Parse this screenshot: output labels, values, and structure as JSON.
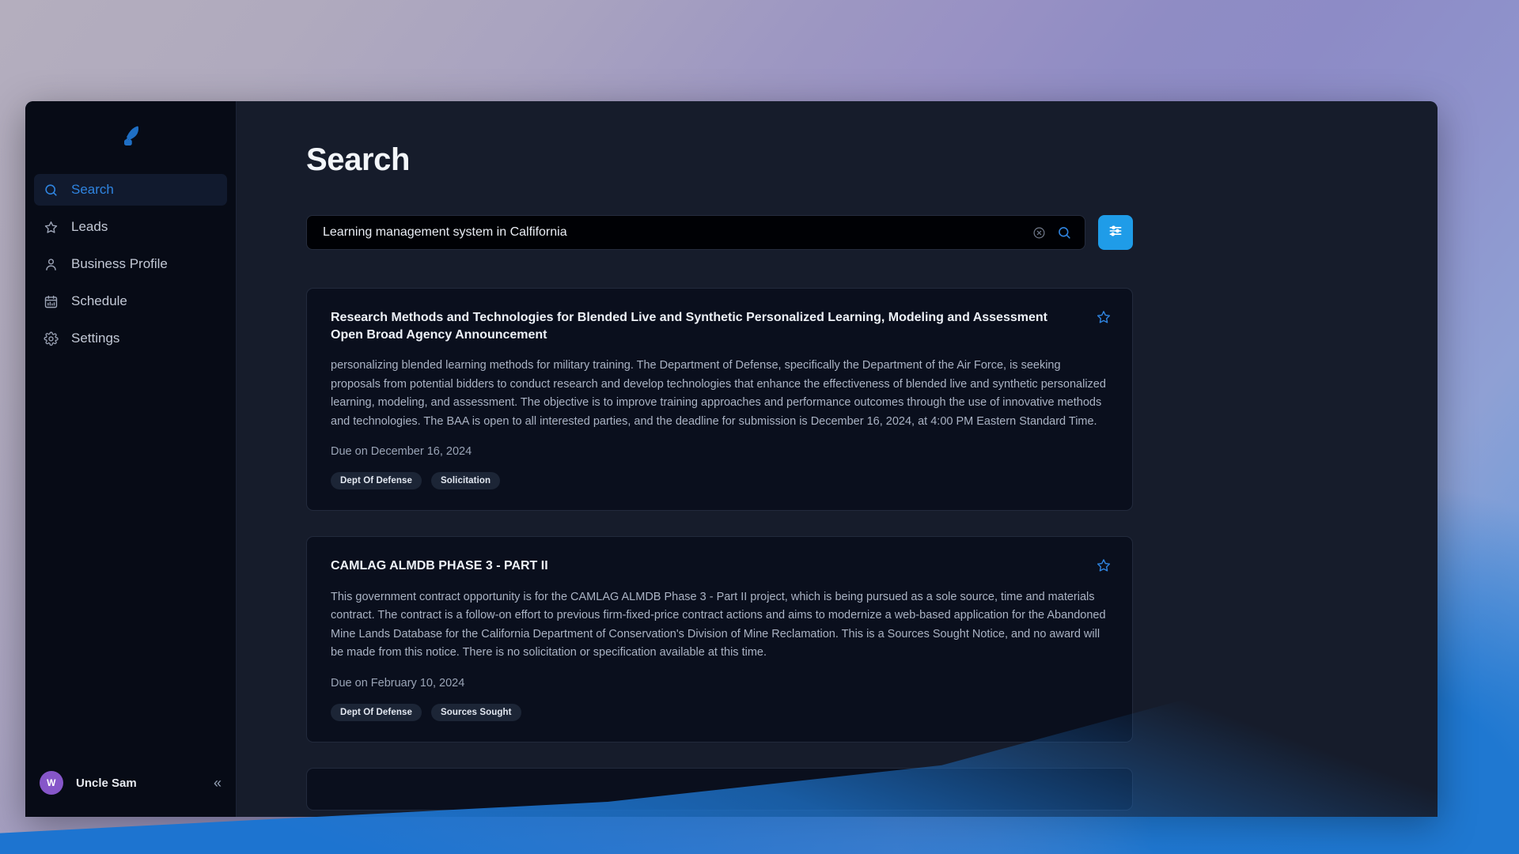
{
  "app": {
    "logo_icon": "quill-pen-icon"
  },
  "sidebar": {
    "items": [
      {
        "label": "Search",
        "icon": "search-icon",
        "active": true
      },
      {
        "label": "Leads",
        "icon": "star-icon",
        "active": false
      },
      {
        "label": "Business Profile",
        "icon": "user-icon",
        "active": false
      },
      {
        "label": "Schedule",
        "icon": "calendar-icon",
        "active": false
      },
      {
        "label": "Settings",
        "icon": "gear-icon",
        "active": false
      }
    ],
    "user": {
      "name": "Uncle Sam",
      "avatar_initial": "W"
    },
    "collapse_glyph": "«"
  },
  "main": {
    "page_title": "Search",
    "search": {
      "value": "Learning management system in Calfifornia",
      "placeholder": "Search",
      "clear_icon": "clear-circle-icon",
      "submit_icon": "search-icon",
      "filter_icon": "filters-sliders-icon"
    },
    "results": [
      {
        "title": "Research Methods and Technologies for Blended Live and Synthetic Personalized Learning, Modeling and Assessment Open Broad Agency Announcement",
        "description": "personalizing blended learning methods for military training. The Department of Defense, specifically the Department of the Air Force, is seeking proposals from potential bidders to conduct research and develop technologies that enhance the effectiveness of blended live and synthetic personalized learning, modeling, and assessment. The objective is to improve training approaches and performance outcomes through the use of innovative methods and technologies. The BAA is open to all interested parties, and the deadline for submission is December 16, 2024, at 4:00 PM Eastern Standard Time.",
        "due": "Due on December 16, 2024",
        "tags": [
          "Dept Of Defense",
          "Solicitation"
        ],
        "bookmark_icon": "star-icon"
      },
      {
        "title": "CAMLAG ALMDB PHASE 3 - PART II",
        "description": "This government contract opportunity is for the CAMLAG ALMDB Phase 3 - Part II project, which is being pursued as a sole source, time and materials contract. The contract is a follow-on effort to previous firm-fixed-price contract actions and aims to modernize a web-based application for the Abandoned Mine Lands Database for the California Department of Conservation's Division of Mine Reclamation. This is a Sources Sought Notice, and no award will be made from this notice. There is no solicitation or specification available at this time.",
        "due": "Due on February 10, 2024",
        "tags": [
          "Dept Of Defense",
          "Sources Sought"
        ],
        "bookmark_icon": "star-icon"
      }
    ]
  },
  "colors": {
    "accent_blue": "#2f84e0",
    "filter_button": "#1f9ce8",
    "avatar_purple": "#8656c9",
    "card_background": "#0a0f1d",
    "sidebar_background": "#070b16",
    "main_background": "#161c2b"
  }
}
